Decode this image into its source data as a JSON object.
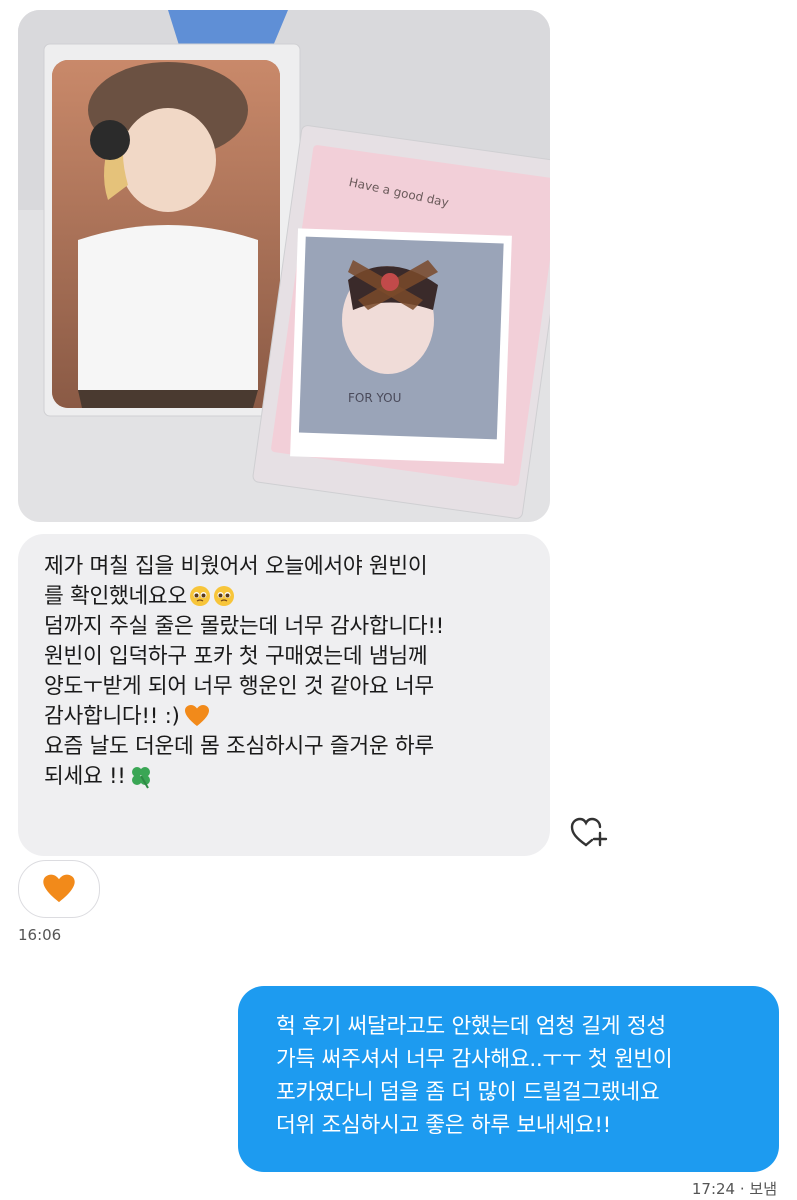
{
  "incoming": {
    "photo_labels": {
      "card_text_top": "Have a good day",
      "card_text_bottom": "FOR YOU"
    },
    "message_lines": [
      "제가 며칠 집을 비웠어서 오늘에서야 원빈이",
      "를 확인했네요오",
      "덤까지 주실 줄은 몰랐는데 너무 감사합니다!!",
      "원빈이 입덕하구 포카 첫 구매였는데 냄님께",
      "양도ㅜ받게 되어 너무 행운인 것 같아요 너무",
      "감사합니다!! :)",
      "요즘 날도 더운데 몸 조심하시구 즐거운 하루",
      "되세요 !!"
    ],
    "emojis": {
      "line2": "pleading-face x2",
      "line6": "orange-heart",
      "line8": "four-leaf-clover"
    },
    "reaction": "orange-heart",
    "timestamp": "16:06"
  },
  "outgoing": {
    "message_lines": [
      "헉 후기 써달라고도 안했는데 엄청 길게 정성",
      "가득 써주셔서 너무 감사해요..ㅜㅜ 첫 원빈이",
      "포카였다니 덤을 좀 더 많이 드릴걸그랬네요",
      "더위 조심하시고 좋은 하루 보내세요!!"
    ],
    "timestamp": "17:24 · 보냄"
  },
  "colors": {
    "incoming_bubble": "#efeff1",
    "outgoing_bubble": "#1d9bf0",
    "orange_heart": "#f28a1a"
  },
  "icons": [
    "heart-plus-icon",
    "orange-heart-icon",
    "pleading-face-icon",
    "four-leaf-clover-icon"
  ]
}
